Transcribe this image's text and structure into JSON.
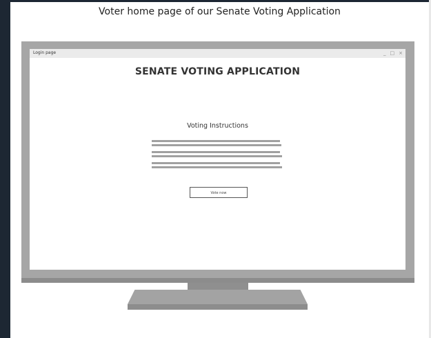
{
  "caption": "Voter home page of our Senate Voting Application",
  "window": {
    "title": "Login page",
    "controls": {
      "minimize": "_",
      "maximize": "□",
      "close": "×"
    }
  },
  "app": {
    "title": "SENATE VOTING APPLICATION",
    "instructions_heading": "Voting Instructions",
    "vote_button_label": "Vote now"
  },
  "colors": {
    "left_strip": "#1d2733",
    "bezel": "#a6a6a6",
    "placeholder_lines": "#a0a0a0"
  }
}
